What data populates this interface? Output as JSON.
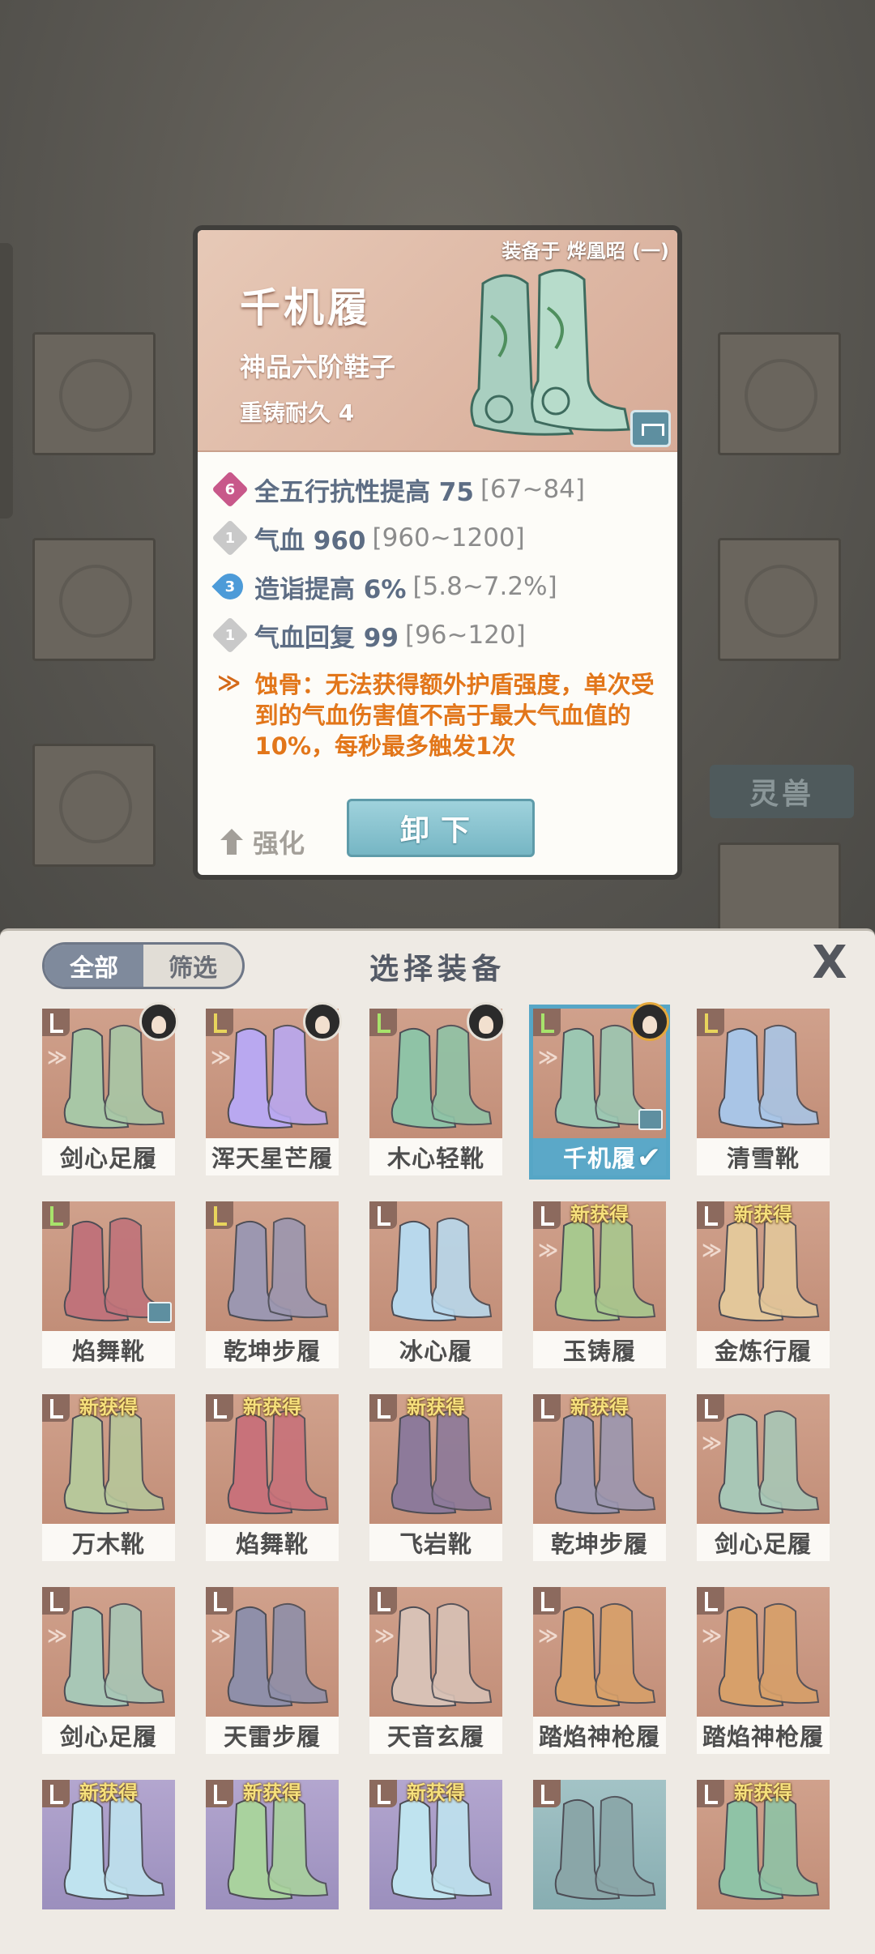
{
  "background": {
    "tab_label": "灵兽"
  },
  "detail": {
    "equipped_on": "装备于 烨凰昭 (一)",
    "name": "千机履",
    "grade": "神品六阶鞋子",
    "durability": "重铸耐久 4",
    "stats": [
      {
        "badge": "6",
        "badge_color": "#c8588a",
        "label": "全五行抗性提高 75",
        "range": "[67~84]"
      },
      {
        "badge": "1",
        "badge_color": "#c9c9c9",
        "label": "气血 960",
        "range": "[960~1200]"
      },
      {
        "badge": "3",
        "badge_color": "#4d9bd8",
        "label": "造诣提高 6%",
        "range": "[5.8~7.2%]"
      },
      {
        "badge": "1",
        "badge_color": "#c9c9c9",
        "label": "气血回复 99",
        "range": "[96~120]"
      }
    ],
    "special_icon": "≫",
    "special_text": "蚀骨：无法获得额外护盾强度，单次受到的气血伤害值不高于最大气血值的10%，每秒最多触发1次",
    "enhance_label": "强化",
    "unequip_label": "卸下"
  },
  "panel": {
    "filter_all": "全部",
    "filter_select": "筛选",
    "title": "选择装备",
    "close": "X",
    "new_tag": "新获得",
    "items": [
      {
        "name": "剑心足履",
        "bg": "orange",
        "tag": "normal",
        "mark": "≫",
        "avatar": "dark",
        "new": false,
        "lock": false,
        "boot": "#a8c7a6"
      },
      {
        "name": "浑天星芒履",
        "bg": "orange",
        "tag": "yellow",
        "mark": "≫",
        "avatar": "dark",
        "new": false,
        "lock": false,
        "boot": "#b9a8f0"
      },
      {
        "name": "木心轻靴",
        "bg": "orange",
        "tag": "green",
        "mark": "",
        "avatar": "dark",
        "new": false,
        "lock": false,
        "boot": "#8fc3a6"
      },
      {
        "name": "千机履",
        "bg": "orange",
        "tag": "green",
        "mark": "≫",
        "avatar": "crown",
        "new": false,
        "lock": true,
        "selected": true,
        "boot": "#9cc7b2"
      },
      {
        "name": "清雪靴",
        "bg": "orange",
        "tag": "yellow",
        "mark": "",
        "avatar": "",
        "new": false,
        "lock": false,
        "boot": "#a9c5e6"
      },
      {
        "name": "焰舞靴",
        "bg": "orange",
        "tag": "green",
        "mark": "",
        "avatar": "",
        "new": false,
        "lock": true,
        "boot": "#c0737a"
      },
      {
        "name": "乾坤步履",
        "bg": "orange",
        "tag": "yellow",
        "mark": "",
        "avatar": "",
        "new": false,
        "lock": false,
        "boot": "#9c97b0"
      },
      {
        "name": "冰心履",
        "bg": "orange",
        "tag": "normal",
        "mark": "",
        "avatar": "",
        "new": false,
        "lock": false,
        "boot": "#b8d8ec"
      },
      {
        "name": "玉铸履",
        "bg": "orange",
        "tag": "normal",
        "mark": "≫",
        "avatar": "",
        "new": true,
        "lock": false,
        "boot": "#a8c88e"
      },
      {
        "name": "金炼行履",
        "bg": "orange",
        "tag": "normal",
        "mark": "≫",
        "avatar": "",
        "new": true,
        "lock": false,
        "boot": "#e3c79a"
      },
      {
        "name": "万木靴",
        "bg": "orange",
        "tag": "normal",
        "mark": "",
        "avatar": "",
        "new": true,
        "lock": false,
        "boot": "#b7c79a"
      },
      {
        "name": "焰舞靴",
        "bg": "orange",
        "tag": "normal",
        "mark": "",
        "avatar": "",
        "new": true,
        "lock": false,
        "boot": "#c8727a"
      },
      {
        "name": "飞岩靴",
        "bg": "orange",
        "tag": "normal",
        "mark": "",
        "avatar": "",
        "new": true,
        "lock": false,
        "boot": "#8d7a9a"
      },
      {
        "name": "乾坤步履",
        "bg": "orange",
        "tag": "normal",
        "mark": "",
        "avatar": "",
        "new": true,
        "lock": false,
        "boot": "#9c97b0"
      },
      {
        "name": "剑心足履",
        "bg": "orange",
        "tag": "normal",
        "mark": "≫",
        "avatar": "",
        "new": false,
        "lock": false,
        "boot": "#a8c7b6"
      },
      {
        "name": "剑心足履",
        "bg": "orange",
        "tag": "normal",
        "mark": "≫",
        "avatar": "",
        "new": false,
        "lock": false,
        "boot": "#a8c7b6"
      },
      {
        "name": "天雷步履",
        "bg": "orange",
        "tag": "normal",
        "mark": "≫",
        "avatar": "",
        "new": false,
        "lock": false,
        "boot": "#8f8fa9"
      },
      {
        "name": "天音玄履",
        "bg": "orange",
        "tag": "normal",
        "mark": "≫",
        "avatar": "",
        "new": false,
        "lock": false,
        "boot": "#d8c1b5"
      },
      {
        "name": "踏焰神枪履",
        "bg": "orange",
        "tag": "normal",
        "mark": "≫",
        "avatar": "",
        "new": false,
        "lock": false,
        "boot": "#d7a06a"
      },
      {
        "name": "踏焰神枪履",
        "bg": "orange",
        "tag": "normal",
        "mark": "≫",
        "avatar": "",
        "new": false,
        "lock": false,
        "boot": "#d7a06a"
      },
      {
        "name": "",
        "bg": "purple",
        "tag": "normal",
        "mark": "",
        "avatar": "",
        "new": true,
        "lock": false,
        "boot": "#bfe3ef"
      },
      {
        "name": "",
        "bg": "purple",
        "tag": "normal",
        "mark": "",
        "avatar": "",
        "new": true,
        "lock": false,
        "boot": "#a9d29e"
      },
      {
        "name": "",
        "bg": "purple",
        "tag": "normal",
        "mark": "",
        "avatar": "",
        "new": true,
        "lock": false,
        "boot": "#bfe3ef"
      },
      {
        "name": "",
        "bg": "teal",
        "tag": "normal",
        "mark": "",
        "avatar": "",
        "new": false,
        "lock": false,
        "boot": "#8aa6a8"
      },
      {
        "name": "",
        "bg": "orange",
        "tag": "normal",
        "mark": "",
        "avatar": "",
        "new": true,
        "lock": false,
        "boot": "#8fc3a6"
      }
    ]
  }
}
